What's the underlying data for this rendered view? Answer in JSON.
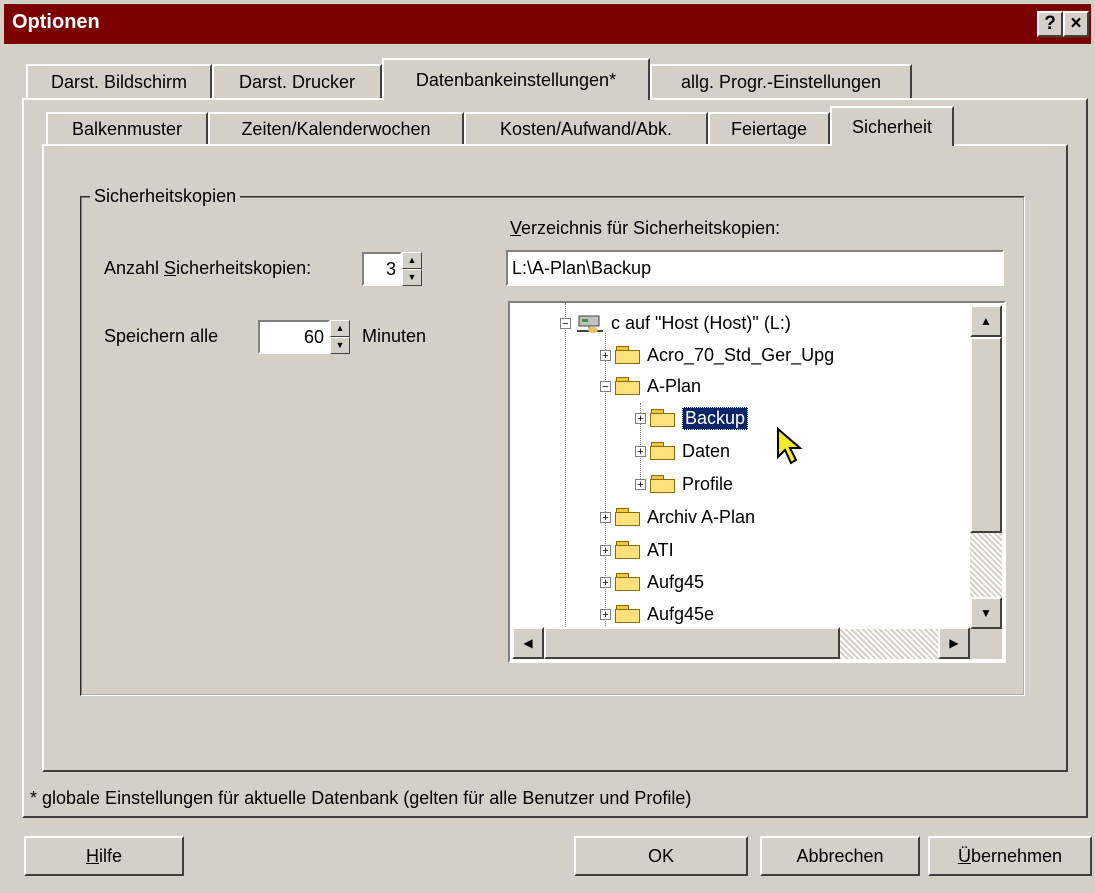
{
  "window": {
    "title": "Optionen",
    "help_btn": "?",
    "close_btn": "×"
  },
  "tabs_top": [
    "Darst. Bildschirm",
    "Darst. Drucker",
    "Datenbankeinstellungen*",
    "allg. Progr.-Einstellungen"
  ],
  "tabs_sub": [
    "Balkenmuster",
    "Zeiten/Kalenderwochen",
    "Kosten/Aufwand/Abk.",
    "Feiertage",
    "Sicherheit"
  ],
  "group": {
    "legend": "Sicherheitskopien",
    "count_label_pre": "Anzahl ",
    "count_label_ul": "S",
    "count_label_post": "icherheitskopien:",
    "count_value": "3",
    "save_label": "Speichern alle",
    "save_value": "60",
    "save_unit": "Minuten",
    "dir_label_ul": "V",
    "dir_label_post": "erzeichnis für Sicherheitskopien:",
    "dir_value": "L:\\A-Plan\\Backup"
  },
  "tree": [
    {
      "label": "c auf \"Host (Host)\" (L:)",
      "sign": "−",
      "type": "drive",
      "level": 0
    },
    {
      "label": "Acro_70_Std_Ger_Upg",
      "sign": "+",
      "type": "folder",
      "level": 1
    },
    {
      "label": "A-Plan",
      "sign": "−",
      "type": "folder",
      "level": 1
    },
    {
      "label": "Backup",
      "sign": "+",
      "type": "folder",
      "level": 2,
      "selected": true
    },
    {
      "label": "Daten",
      "sign": "+",
      "type": "folder",
      "level": 2
    },
    {
      "label": "Profile",
      "sign": "+",
      "type": "folder",
      "level": 2
    },
    {
      "label": "Archiv A-Plan",
      "sign": "+",
      "type": "folder",
      "level": 1
    },
    {
      "label": "ATI",
      "sign": "+",
      "type": "folder",
      "level": 1
    },
    {
      "label": "Aufg45",
      "sign": "+",
      "type": "folder",
      "level": 1
    },
    {
      "label": "Aufg45e",
      "sign": "+",
      "type": "folder",
      "level": 1
    }
  ],
  "footnote": "* globale Einstellungen für aktuelle Datenbank (gelten für alle Benutzer und Profile)",
  "buttons": {
    "help_ul": "H",
    "help_post": "ilfe",
    "ok": "OK",
    "cancel": "Abbrechen",
    "apply_ul": "Ü",
    "apply_post": "bernehmen"
  }
}
